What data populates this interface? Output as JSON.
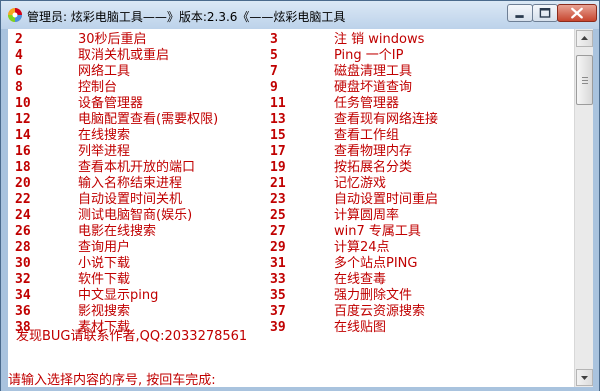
{
  "window": {
    "title": "管理员:  炫彩电脑工具——》版本:2.3.6《——炫彩电脑工具",
    "icon": "colorful-app-icon"
  },
  "menu": {
    "left": [
      {
        "num": "2",
        "label": "30秒后重启",
        "mono_prefix": true
      },
      {
        "num": "4",
        "label": "取消关机或重启"
      },
      {
        "num": "6",
        "label": "网络工具"
      },
      {
        "num": "8",
        "label": "控制台"
      },
      {
        "num": "10",
        "label": "设备管理器"
      },
      {
        "num": "12",
        "label": "电脑配置查看(需要权限)"
      },
      {
        "num": "14",
        "label": "在线搜索"
      },
      {
        "num": "16",
        "label": "列举进程"
      },
      {
        "num": "18",
        "label": "查看本机开放的端口"
      },
      {
        "num": "20",
        "label": "输入名称结束进程"
      },
      {
        "num": "22",
        "label": "自动设置时间关机"
      },
      {
        "num": "24",
        "label": "测试电脑智商(娱乐)"
      },
      {
        "num": "26",
        "label": "电影在线搜索"
      },
      {
        "num": "28",
        "label": "查询用户"
      },
      {
        "num": "30",
        "label": "小说下载"
      },
      {
        "num": "32",
        "label": "软件下载"
      },
      {
        "num": "34",
        "label": "中文显示ping"
      },
      {
        "num": "36",
        "label": "影视搜索"
      },
      {
        "num": "38",
        "label": "素材下载"
      }
    ],
    "right": [
      {
        "num": "3",
        "label": "注 销 windows"
      },
      {
        "num": "5",
        "label": "Ping 一个IP"
      },
      {
        "num": "7",
        "label": "磁盘清理工具"
      },
      {
        "num": "9",
        "label": "硬盘坏道查询"
      },
      {
        "num": "11",
        "label": "任务管理器"
      },
      {
        "num": "13",
        "label": "查看现有网络连接"
      },
      {
        "num": "15",
        "label": "查看工作组"
      },
      {
        "num": "17",
        "label": "查看物理内存"
      },
      {
        "num": "19",
        "label": "按拓展名分类"
      },
      {
        "num": "21",
        "label": "记忆游戏"
      },
      {
        "num": "23",
        "label": "自动设置时间重启"
      },
      {
        "num": "25",
        "label": "计算圆周率"
      },
      {
        "num": "27",
        "label": "win7 专属工具"
      },
      {
        "num": "29",
        "label": "计算24点"
      },
      {
        "num": "31",
        "label": "多个站点PING"
      },
      {
        "num": "33",
        "label": "在线查毒"
      },
      {
        "num": "35",
        "label": "强力删除文件"
      },
      {
        "num": "37",
        "label": "百度云资源搜索"
      },
      {
        "num": "39",
        "label": "在线贴图"
      }
    ]
  },
  "bug_report": "发现BUG请联系作者,QQ:2033278561",
  "prompt": "请输入选择内容的序号, 按回车完成:",
  "colors": {
    "text": "#c00000",
    "console_bg": "#ffffff",
    "frame": "#a9c3de"
  }
}
